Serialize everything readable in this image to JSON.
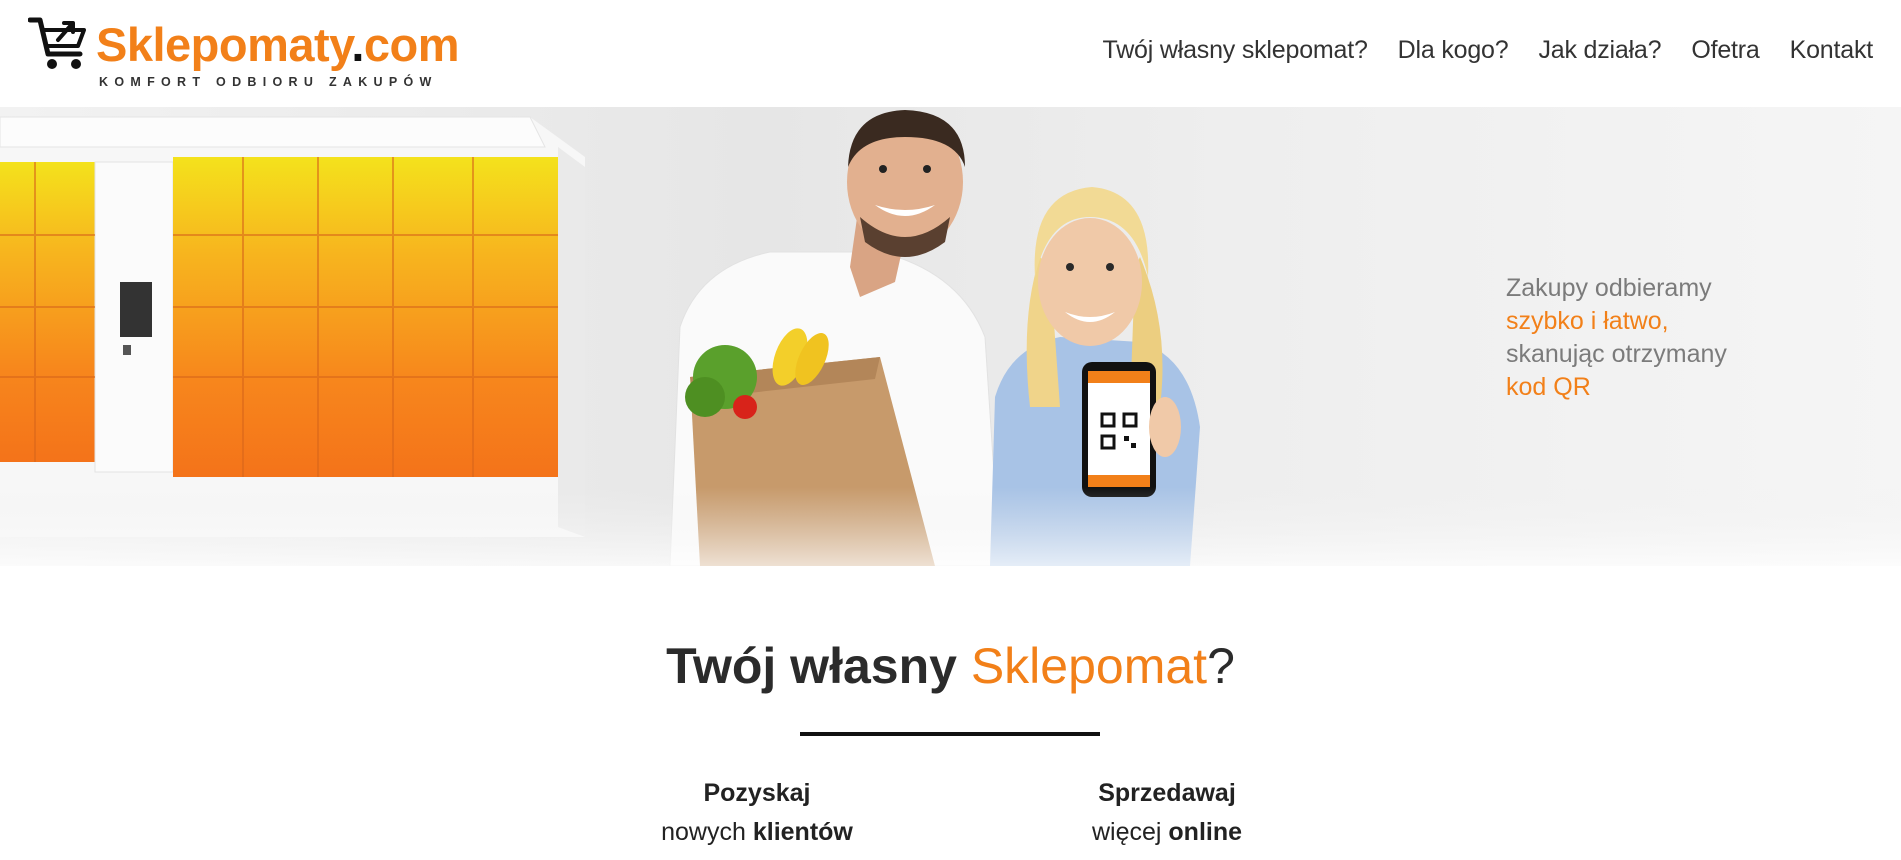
{
  "brand": {
    "name_part1": "Sklepomaty",
    "name_dot": ".",
    "name_part2": "com",
    "tagline": "KOMFORT ODBIORU ZAKUPÓW",
    "accent_color": "#f28019"
  },
  "nav": {
    "items": [
      {
        "label": "Twój własny sklepomat?"
      },
      {
        "label": "Dla kogo?"
      },
      {
        "label": "Jak działa?"
      },
      {
        "label": "Ofetra"
      },
      {
        "label": "Kontakt"
      }
    ]
  },
  "hero": {
    "line1": "Zakupy odbieramy",
    "line2": "szybko i łatwo,",
    "line3": "skanując otrzymany",
    "line4": "kod QR"
  },
  "section": {
    "title_bold": "Twój własny",
    "title_accent": "Sklepomat",
    "title_end": "?"
  },
  "features": [
    {
      "title": "Pozyskaj",
      "sub_plain": "nowych",
      "sub_bold": "klientów"
    },
    {
      "title": "Sprzedawaj",
      "sub_plain": "więcej",
      "sub_bold": "online"
    }
  ]
}
